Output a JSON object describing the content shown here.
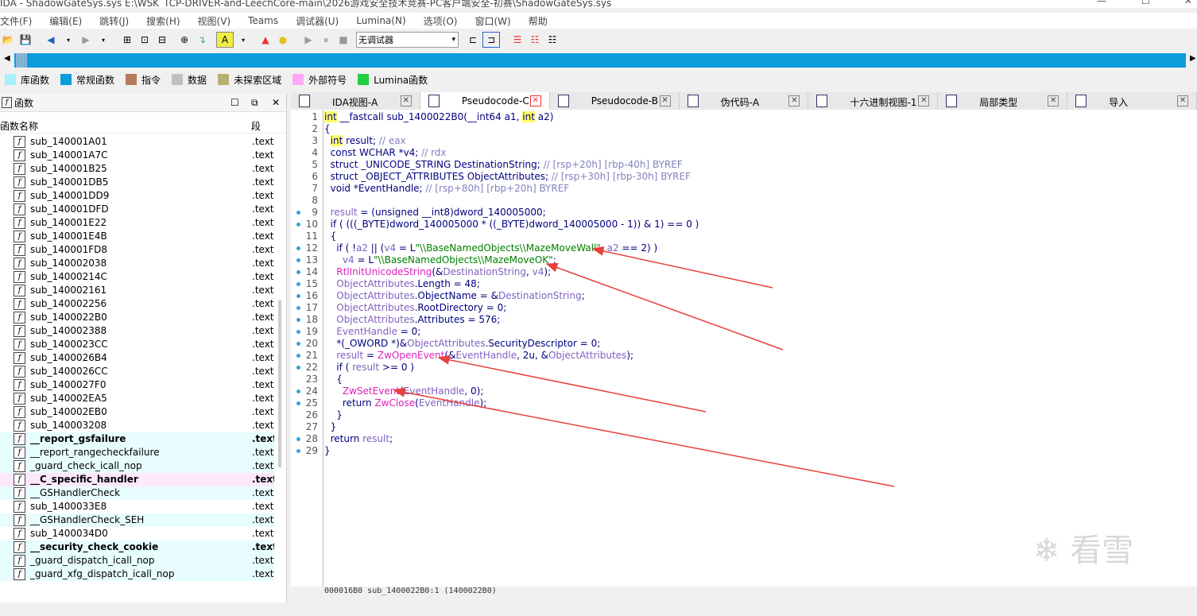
{
  "window": {
    "title": "IDA - ShadowGateSys.sys E:\\WSK_TCP-DRIVER-and-LeechCore-main\\2026游戏安全技术竞赛-PC客户端安全-初赛\\ShadowGateSys.sys"
  },
  "menu": [
    "文件(F)",
    "编辑(E)",
    "跳转(J)",
    "搜索(H)",
    "视图(V)",
    "Teams",
    "调试器(U)",
    "Lumina(N)",
    "选项(O)",
    "窗口(W)",
    "帮助"
  ],
  "toolbar": {
    "debugger_select": "无调试器"
  },
  "legend": [
    {
      "label": "库函数",
      "color": "#a8f0f8"
    },
    {
      "label": "常规函数",
      "color": "#0a9cdb"
    },
    {
      "label": "指令",
      "color": "#b87a5a"
    },
    {
      "label": "数据",
      "color": "#c0c0c0"
    },
    {
      "label": "未探索区域",
      "color": "#b8b070"
    },
    {
      "label": "外部符号",
      "color": "#ffa8f8"
    },
    {
      "label": "Lumina函数",
      "color": "#20d040"
    }
  ],
  "functions_panel": {
    "title": "函数",
    "col_name": "函数名称",
    "col_seg": "段",
    "rows": [
      {
        "name": "sub_140001A01",
        "seg": ".text",
        "style": ""
      },
      {
        "name": "sub_140001A7C",
        "seg": ".text",
        "style": ""
      },
      {
        "name": "sub_140001B25",
        "seg": ".text",
        "style": ""
      },
      {
        "name": "sub_140001DB5",
        "seg": ".text",
        "style": ""
      },
      {
        "name": "sub_140001DD9",
        "seg": ".text",
        "style": ""
      },
      {
        "name": "sub_140001DFD",
        "seg": ".text",
        "style": ""
      },
      {
        "name": "sub_140001E22",
        "seg": ".text",
        "style": ""
      },
      {
        "name": "sub_140001E4B",
        "seg": ".text",
        "style": ""
      },
      {
        "name": "sub_140001FD8",
        "seg": ".text",
        "style": ""
      },
      {
        "name": "sub_140002038",
        "seg": ".text",
        "style": ""
      },
      {
        "name": "sub_14000214C",
        "seg": ".text",
        "style": ""
      },
      {
        "name": "sub_140002161",
        "seg": ".text",
        "style": ""
      },
      {
        "name": "sub_140002256",
        "seg": ".text",
        "style": ""
      },
      {
        "name": "sub_1400022B0",
        "seg": ".text",
        "style": ""
      },
      {
        "name": "sub_140002388",
        "seg": ".text",
        "style": ""
      },
      {
        "name": "sub_1400023CC",
        "seg": ".text",
        "style": ""
      },
      {
        "name": "sub_1400026B4",
        "seg": ".text",
        "style": ""
      },
      {
        "name": "sub_1400026CC",
        "seg": ".text",
        "style": ""
      },
      {
        "name": "sub_1400027F0",
        "seg": ".text",
        "style": ""
      },
      {
        "name": "sub_140002EA5",
        "seg": ".text",
        "style": ""
      },
      {
        "name": "sub_140002EB0",
        "seg": ".text",
        "style": ""
      },
      {
        "name": "sub_140003208",
        "seg": ".text",
        "style": ""
      },
      {
        "name": "__report_gsfailure",
        "seg": ".text",
        "style": "lib bold"
      },
      {
        "name": "__report_rangecheckfailure",
        "seg": ".text",
        "style": "lib"
      },
      {
        "name": "_guard_check_icall_nop",
        "seg": ".text",
        "style": "lib"
      },
      {
        "name": "__C_specific_handler",
        "seg": ".text",
        "style": "ext bold"
      },
      {
        "name": "__GSHandlerCheck",
        "seg": ".text",
        "style": "lib"
      },
      {
        "name": "sub_1400033E8",
        "seg": ".text",
        "style": ""
      },
      {
        "name": "__GSHandlerCheck_SEH",
        "seg": ".text",
        "style": "lib"
      },
      {
        "name": "sub_1400034D0",
        "seg": ".text",
        "style": ""
      },
      {
        "name": "__security_check_cookie",
        "seg": ".text",
        "style": "lib bold"
      },
      {
        "name": "_guard_dispatch_icall_nop",
        "seg": ".text",
        "style": "lib"
      },
      {
        "name": "_guard_xfg_dispatch_icall_nop",
        "seg": ".text",
        "style": "lib"
      }
    ]
  },
  "tabs": [
    {
      "label": "IDA视图-A",
      "active": false
    },
    {
      "label": "Pseudocode-C",
      "active": true
    },
    {
      "label": "Pseudocode-B",
      "active": false
    },
    {
      "label": "伪代码-A",
      "active": false
    },
    {
      "label": "十六进制视图-1",
      "active": false
    },
    {
      "label": "局部类型",
      "active": false
    },
    {
      "label": "导入",
      "active": false
    }
  ],
  "code": {
    "lines": [
      {
        "n": "1",
        "dot": false,
        "html": "<span class='kw'>int</span> __fastcall sub_1400022B0(__int64 a1, <span class='kw'>int</span> a2)"
      },
      {
        "n": "2",
        "dot": false,
        "html": "{"
      },
      {
        "n": "3",
        "dot": false,
        "html": "  <span class='kw'>int</span> result; <span class='cm'>// eax</span>"
      },
      {
        "n": "4",
        "dot": false,
        "html": "  const WCHAR *v4; <span class='cm'>// rdx</span>"
      },
      {
        "n": "5",
        "dot": false,
        "html": "  struct _UNICODE_STRING DestinationString; <span class='cm'>// [rsp+20h] [rbp-40h] BYREF</span>"
      },
      {
        "n": "6",
        "dot": false,
        "html": "  struct _OBJECT_ATTRIBUTES ObjectAttributes; <span class='cm'>// [rsp+30h] [rbp-30h] BYREF</span>"
      },
      {
        "n": "7",
        "dot": false,
        "html": "  void *EventHandle; <span class='cm'>// [rsp+80h] [rbp+20h] BYREF</span>"
      },
      {
        "n": "8",
        "dot": false,
        "html": ""
      },
      {
        "n": "9",
        "dot": true,
        "html": "  <span class='vr'>result</span> = (unsigned __int8)<span class='gl'>dword_140005000</span>;"
      },
      {
        "n": "10",
        "dot": true,
        "html": "  if ( (((_BYTE)<span class='gl'>dword_140005000</span> * ((_BYTE)<span class='gl'>dword_140005000</span> - 1)) &amp; 1) == 0 )"
      },
      {
        "n": "11",
        "dot": false,
        "html": "  {"
      },
      {
        "n": "12",
        "dot": true,
        "html": "    if ( !<span class='vr'>a2</span> || (<span class='vr'>v4</span> = L<span class='str'>\"\\\\BaseNamedObjects\\\\MazeMoveWall\"</span>, <span class='vr'>a2</span> == 2) )"
      },
      {
        "n": "13",
        "dot": true,
        "html": "      <span class='vr'>v4</span> = L<span class='str'>\"\\\\BaseNamedObjects\\\\MazeMoveOK\"</span>;"
      },
      {
        "n": "14",
        "dot": true,
        "html": "    <span class='fnc'>RtlInitUnicodeString</span>(&amp;<span class='vr'>DestinationString</span>, <span class='vr'>v4</span>);"
      },
      {
        "n": "15",
        "dot": true,
        "html": "    <span class='vr'>ObjectAttributes</span>.Length = 48;"
      },
      {
        "n": "16",
        "dot": true,
        "html": "    <span class='vr'>ObjectAttributes</span>.ObjectName = &amp;<span class='vr'>DestinationString</span>;"
      },
      {
        "n": "17",
        "dot": true,
        "html": "    <span class='vr'>ObjectAttributes</span>.RootDirectory = 0;"
      },
      {
        "n": "18",
        "dot": true,
        "html": "    <span class='vr'>ObjectAttributes</span>.Attributes = 576;"
      },
      {
        "n": "19",
        "dot": true,
        "html": "    <span class='vr'>EventHandle</span> = 0;"
      },
      {
        "n": "20",
        "dot": true,
        "html": "    *(_OWORD *)&amp;<span class='vr'>ObjectAttributes</span>.SecurityDescriptor = 0;"
      },
      {
        "n": "21",
        "dot": true,
        "html": "    <span class='vr'>result</span> = <span class='fnc'>ZwOpenEvent</span>(&amp;<span class='vr'>EventHandle</span>, 2u, &amp;<span class='vr'>ObjectAttributes</span>);"
      },
      {
        "n": "22",
        "dot": true,
        "html": "    if ( <span class='vr'>result</span> &gt;= 0 )"
      },
      {
        "n": "23",
        "dot": false,
        "html": "    {"
      },
      {
        "n": "24",
        "dot": true,
        "html": "      <span class='fnc'>ZwSetEvent</span>(<span class='vr'>EventHandle</span>, 0);"
      },
      {
        "n": "25",
        "dot": true,
        "html": "      return <span class='fnc'>ZwClose</span>(<span class='vr'>EventHandle</span>);"
      },
      {
        "n": "26",
        "dot": false,
        "html": "    }"
      },
      {
        "n": "27",
        "dot": false,
        "html": "  }"
      },
      {
        "n": "28",
        "dot": true,
        "html": "  return <span class='vr'>result</span>;"
      },
      {
        "n": "29",
        "dot": true,
        "html": "}"
      }
    ]
  },
  "statusbar": "000016B0 sub_1400022B0:1 (1400022B0)",
  "watermark": "看雪"
}
